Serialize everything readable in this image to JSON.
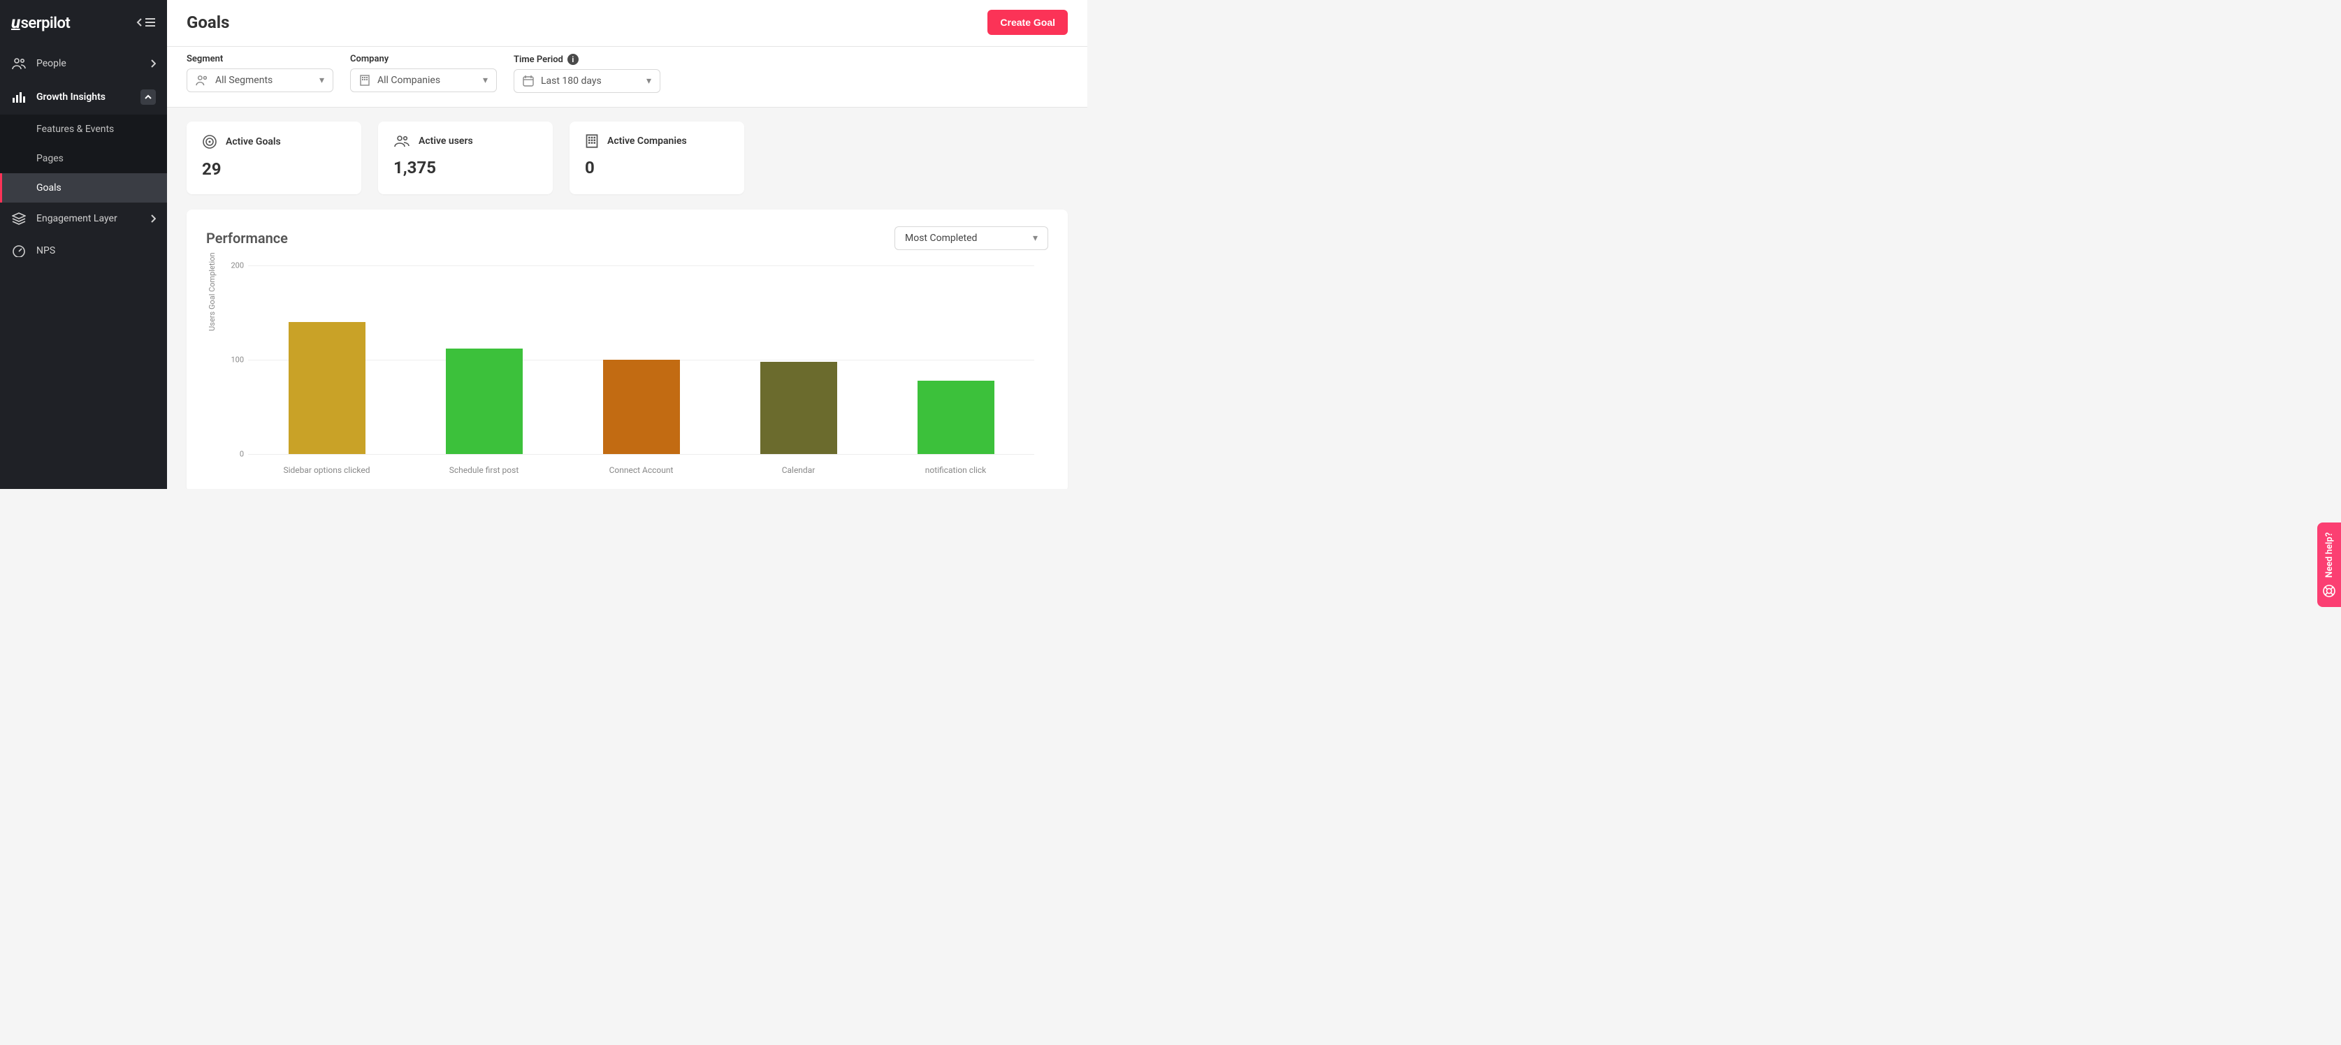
{
  "brand": "userpilot",
  "header": {
    "page_title": "Goals",
    "create_button": "Create Goal"
  },
  "sidebar": {
    "items": [
      {
        "label": "People",
        "expandable": true
      },
      {
        "label": "Growth Insights",
        "expanded": true,
        "children": [
          {
            "label": "Features & Events"
          },
          {
            "label": "Pages"
          },
          {
            "label": "Goals",
            "active": true
          }
        ]
      },
      {
        "label": "Engagement Layer",
        "expandable": true
      },
      {
        "label": "NPS"
      }
    ]
  },
  "filters": {
    "segment": {
      "label": "Segment",
      "value": "All Segments"
    },
    "company": {
      "label": "Company",
      "value": "All Companies"
    },
    "time": {
      "label": "Time Period",
      "value": "Last 180 days"
    }
  },
  "stats": {
    "active_goals": {
      "label": "Active Goals",
      "value": "29"
    },
    "active_users": {
      "label": "Active users",
      "value": "1,375"
    },
    "active_companies": {
      "label": "Active Companies",
      "value": "0"
    }
  },
  "performance": {
    "title": "Performance",
    "sort": "Most Completed"
  },
  "help_tab": "Need help?",
  "chart_data": {
    "type": "bar",
    "title": "Performance",
    "ylabel": "Users Goal Completion",
    "xlabel": "",
    "ylim": [
      0,
      200
    ],
    "yticks": [
      0,
      100,
      200
    ],
    "categories": [
      "Sidebar options clicked",
      "Schedule first post",
      "Connect Account",
      "Calendar",
      "notification click"
    ],
    "values": [
      140,
      112,
      100,
      98,
      78
    ],
    "colors": [
      "#c9a227",
      "#3cc13b",
      "#c26b12",
      "#6b6b2d",
      "#3cc13b"
    ]
  }
}
